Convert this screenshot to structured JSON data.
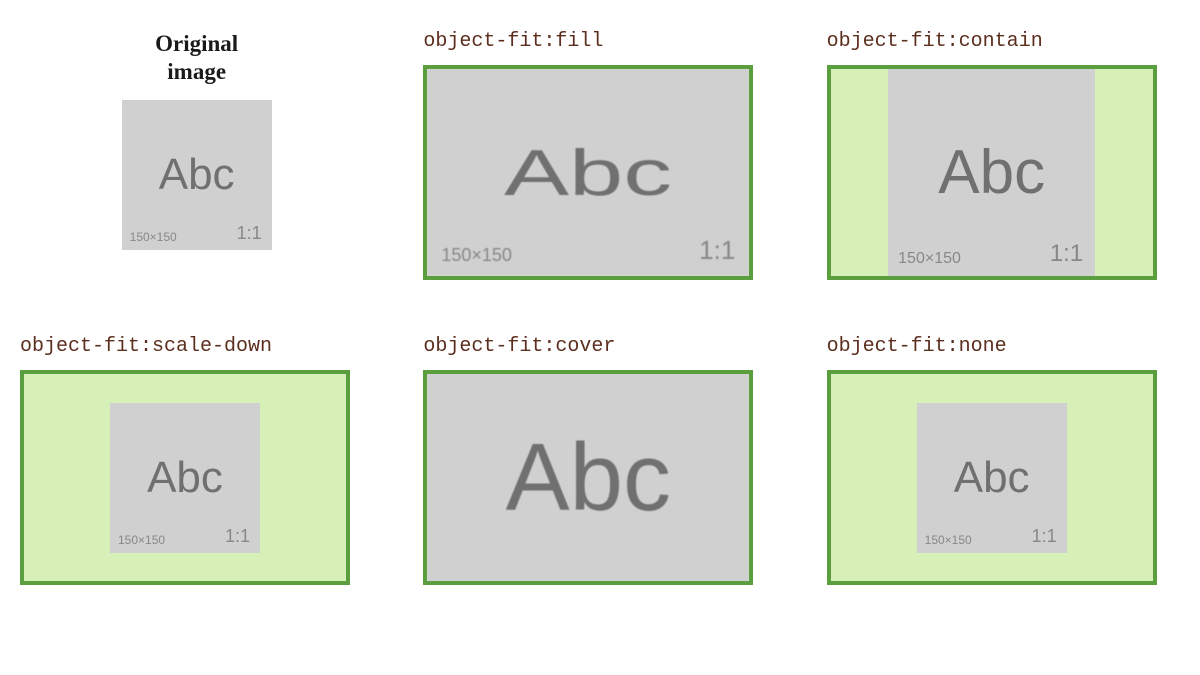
{
  "sample": {
    "text": "Abc",
    "dimensions": "150×150",
    "ratio": "1:1"
  },
  "cells": {
    "original": {
      "label_line1": "Original",
      "label_line2": "image"
    },
    "fill": {
      "label": "object-fit:fill"
    },
    "contain": {
      "label": "object-fit:contain"
    },
    "scale_down": {
      "label": "object-fit:scale-down"
    },
    "cover": {
      "label": "object-fit:cover"
    },
    "none": {
      "label": "object-fit:none"
    }
  }
}
